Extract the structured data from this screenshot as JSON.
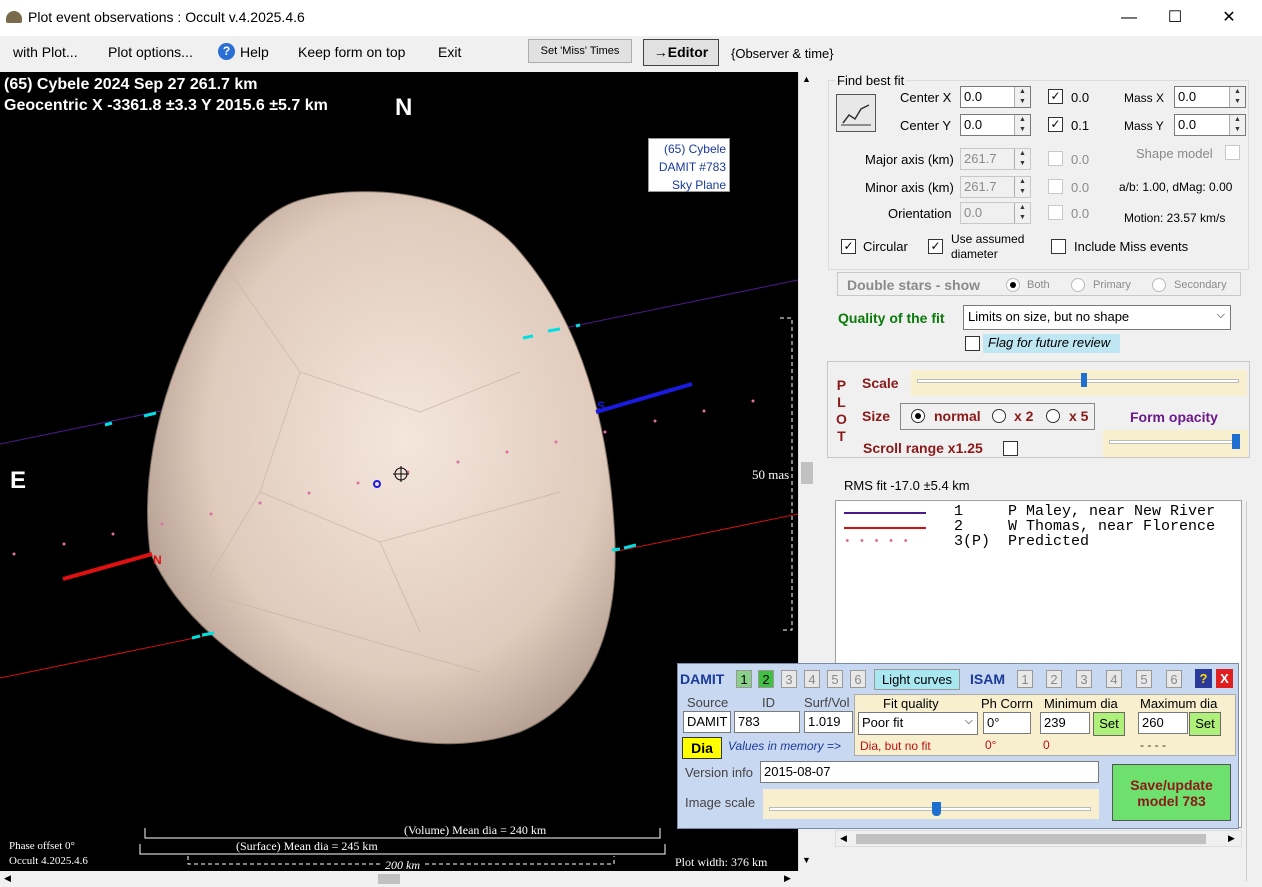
{
  "window": {
    "title": "Plot event observations : Occult v.4.2025.4.6",
    "minimize": "—",
    "maximize": "☐",
    "close": "✕"
  },
  "menu": {
    "with_plot": "with Plot...",
    "plot_options": "Plot options...",
    "help": "Help",
    "keep_on_top": "Keep form on top",
    "exit": "Exit",
    "set_miss": "Set 'Miss' Times",
    "editor": "→Editor",
    "observer_time": "{Observer & time}"
  },
  "plot": {
    "line1": "(65) Cybele  2024 Sep 27   261.7 km",
    "line2": "Geocentric  X  -3361.8 ±3.3  Y 2015.6 ±5.7 km",
    "north": "N",
    "east": "E",
    "model_box": [
      "(65) Cybele",
      "DAMIT #783",
      "Sky Plane"
    ],
    "scale_mas": "50 mas",
    "volume_dia": "(Volume) Mean dia = 240 km",
    "surface_dia": "(Surface) Mean dia = 245 km",
    "km_scale": "200 km",
    "phase_offset": "Phase offset 0°",
    "version": "Occult 4.2025.4.6",
    "plot_width": "Plot width: 376 km",
    "chord_s": "S",
    "chord_n": "N"
  },
  "fit": {
    "group_label": "Find best fit",
    "center_x_label": "Center X",
    "center_x": "0.0",
    "center_y_label": "Center Y",
    "center_y": "0.0",
    "center_x_step": "0.0",
    "center_y_step": "0.1",
    "mass_x_label": "Mass X",
    "mass_x": "0.0",
    "mass_y_label": "Mass Y",
    "mass_y": "0.0",
    "major_label": "Major axis (km)",
    "major": "261.7",
    "major_step": "0.0",
    "minor_label": "Minor axis (km)",
    "minor": "261.7",
    "minor_step": "0.0",
    "orient_label": "Orientation",
    "orient": "0.0",
    "orient_step": "0.0",
    "shape_model": "Shape model",
    "ab_dmag": "a/b: 1.00, dMag: 0.00",
    "motion": "Motion: 23.57 km/s",
    "circular": "Circular",
    "use_assumed": "Use assumed diameter",
    "include_miss": "Include Miss events"
  },
  "double": {
    "label": "Double stars - show",
    "both": "Both",
    "primary": "Primary",
    "secondary": "Secondary"
  },
  "quality": {
    "label": "Quality of the fit",
    "value": "Limits on size, but no shape",
    "flag": "Flag for future review"
  },
  "plotctl": {
    "side": [
      "P",
      "L",
      "O",
      "T"
    ],
    "scale": "Scale",
    "scale_pos": 0.52,
    "size": "Size",
    "normal": "normal",
    "x2": "x 2",
    "x5": "x 5",
    "form_opacity": "Form opacity",
    "opacity_pos": 0.97,
    "scroll_range": "Scroll range x1.25"
  },
  "rms": "RMS fit -17.0 ±5.4 km",
  "legend": [
    {
      "num": "1",
      "text": "P Maley, near New River",
      "color": "#4b1a8a"
    },
    {
      "num": "2",
      "text": "W Thomas, near Florence",
      "color": "#d01010"
    },
    {
      "num": "3(P)",
      "text": "Predicted",
      "color": "#e070a0"
    }
  ],
  "damit": {
    "title": "DAMIT",
    "nums": [
      "1",
      "2",
      "3",
      "4",
      "5",
      "6"
    ],
    "light_curves": "Light curves",
    "isam": "ISAM",
    "isam_nums": [
      "1",
      "2",
      "3",
      "4",
      "5",
      "6"
    ],
    "help": "?",
    "close": "X",
    "source_label": "Source",
    "id_label": "ID",
    "surf_label": "Surf/Vol",
    "source": "DAMIT",
    "id": "783",
    "surf": "1.019",
    "fit_quality_label": "Fit quality",
    "fit_quality": "Poor fit",
    "phcorr_label": "Ph Corrn",
    "phcorr": "0°",
    "min_label": "Minimum dia",
    "min": "239",
    "max_label": "Maximum dia",
    "max": "260",
    "set": "Set",
    "dia": "Dia",
    "in_memory": "Values in memory =>",
    "mem_quality": "Dia, but no fit",
    "mem_phcorr": "0°",
    "mem_min": "0",
    "mem_max": "- - - -",
    "version_label": "Version info",
    "version": "2015-08-07",
    "image_scale": "Image scale",
    "image_scale_pos": 0.52,
    "save": "Save/update model 783"
  }
}
